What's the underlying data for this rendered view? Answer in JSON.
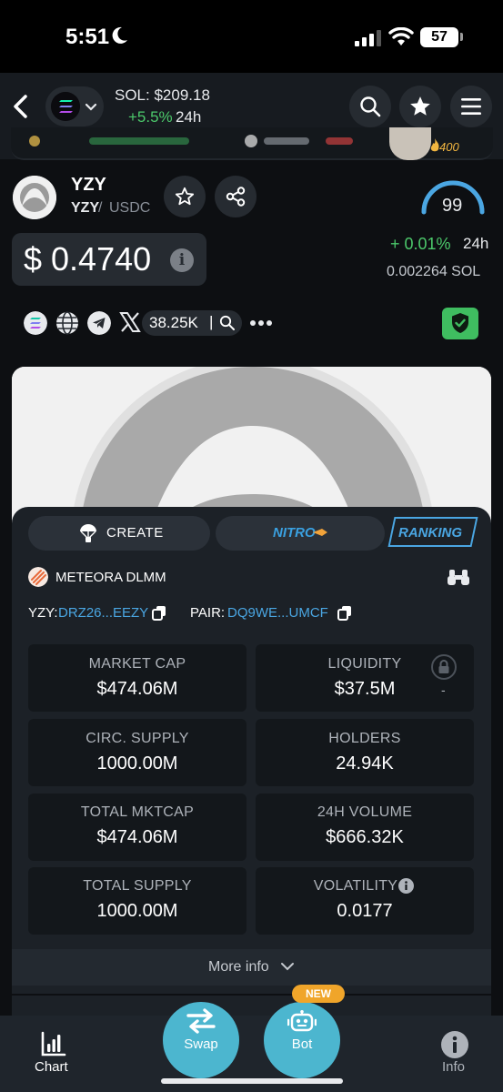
{
  "status_bar": {
    "time": "5:51",
    "battery": "57"
  },
  "header": {
    "sol_price": "SOL: $209.18",
    "sol_change": "+5.5%",
    "sol_change_period": "24h"
  },
  "ticker": {
    "count": "400"
  },
  "token": {
    "name": "YZY",
    "pair_base": "YZY",
    "pair_sep": "/",
    "pair_quote": "USDC",
    "score": "99",
    "price": "$ 0.4740",
    "info_glyph": "i",
    "change": "+ 0.01%",
    "change_period": "24h",
    "sol_amount": "0.002264  SOL"
  },
  "socials": {
    "followers": "38.25K",
    "followers_sep": "|"
  },
  "panel": {
    "tabs": {
      "create": "CREATE",
      "nitro": "NITRO",
      "ranking": "RANKING"
    },
    "dex": "METEORA DLMM",
    "token_addr_label": "YZY:",
    "token_addr": "DRZ26...EEZY",
    "pair_addr_label": "PAIR:",
    "pair_addr": "DQ9WE...UMCF",
    "stats": [
      {
        "label": "MARKET CAP",
        "value": "$474.06M"
      },
      {
        "label": "LIQUIDITY",
        "value": "$37.5M"
      },
      {
        "label": "CIRC. SUPPLY",
        "value": "1000.00M"
      },
      {
        "label": "HOLDERS",
        "value": "24.94K"
      },
      {
        "label": "TOTAL MKTCAP",
        "value": "$474.06M"
      },
      {
        "label": "24H VOLUME",
        "value": "$666.32K"
      },
      {
        "label": "TOTAL SUPPLY",
        "value": "1000.00M"
      },
      {
        "label": "VOLATILITY",
        "value": "0.0177"
      }
    ],
    "liquidity_note": "-",
    "more_info": "More info"
  },
  "bottom_nav": {
    "chart": "Chart",
    "swap": "Swap",
    "bot": "Bot",
    "bot_badge": "NEW",
    "info": "Info"
  },
  "colors": {
    "positive": "#4cc96b",
    "accent": "#4aa6e2",
    "fab": "#4cb6cf",
    "badge": "#f0a52a"
  }
}
